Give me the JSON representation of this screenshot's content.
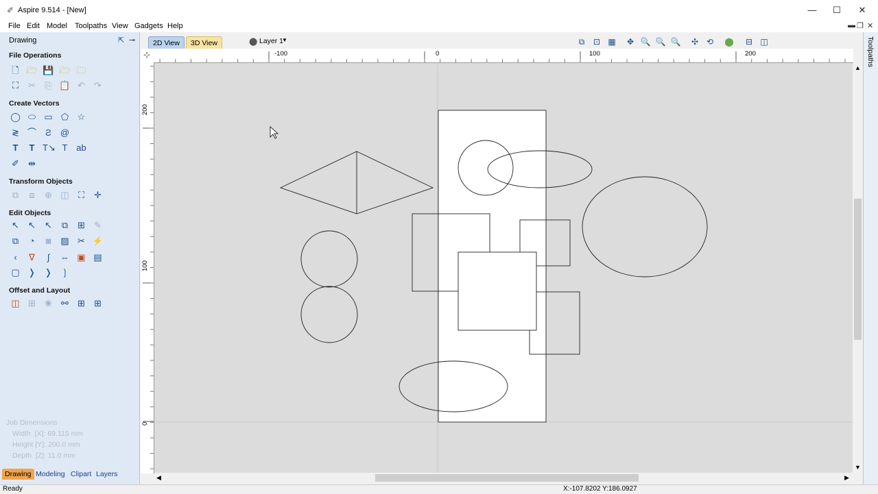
{
  "window": {
    "title": "Aspire 9.514 - [New]",
    "minimize_glyph": "—",
    "maximize_glyph": "☐",
    "close_glyph": "✕"
  },
  "menu": {
    "items": [
      "File",
      "Edit",
      "Model",
      "Toolpaths",
      "View",
      "Gadgets",
      "Help"
    ]
  },
  "left_panel": {
    "header": "Drawing",
    "sections": {
      "file_operations": "File Operations",
      "create_vectors": "Create Vectors",
      "transform_objects": "Transform Objects",
      "edit_objects": "Edit Objects",
      "offset_and_layout": "Offset and Layout"
    },
    "job_dimensions": {
      "title": "Job Dimensions",
      "width": "Width  [X]: 69.115 mm",
      "height": "Height [Y]: 200.0 mm",
      "depth": "Depth  [Z]: 11.0 mm"
    },
    "tabs": [
      "Drawing",
      "Modeling",
      "Clipart",
      "Layers"
    ]
  },
  "view": {
    "tab_2d": "2D View",
    "tab_3d": "3D View",
    "layer_label": "Layer 1"
  },
  "ruler": {
    "top_labels": [
      "-100",
      "0",
      "100",
      "200"
    ],
    "left_labels": [
      "200",
      "100",
      "0"
    ]
  },
  "right_dock": {
    "label": "Toolpaths"
  },
  "status": {
    "left": "Ready",
    "coords": "X:-107.8202 Y:186.0927"
  },
  "colors": {
    "panel_bg": "#dfe9f5",
    "canvas_bg": "#dcdcdc",
    "job_area": "#ffffff",
    "active_tab": "#f2a44a",
    "tab_2d": "#bcd3ee",
    "tab_3d": "#f7e3a2"
  }
}
